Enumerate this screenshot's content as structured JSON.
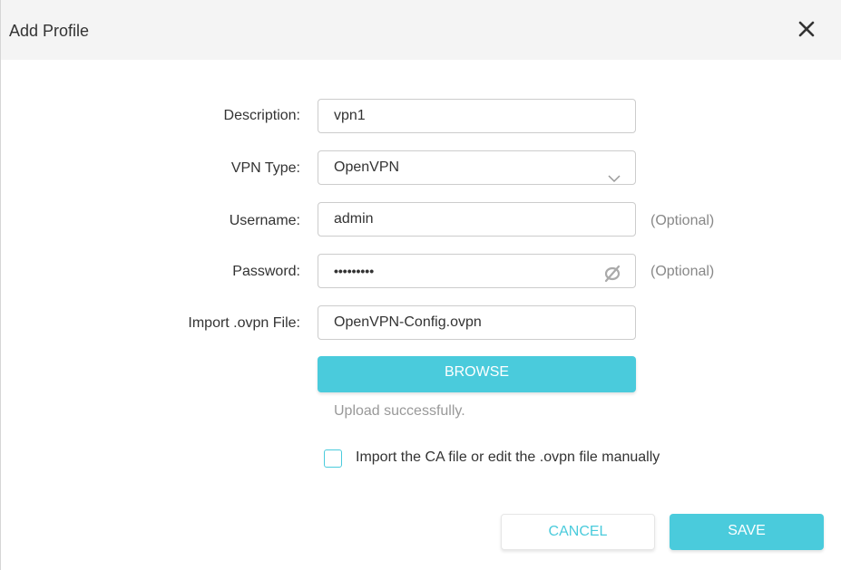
{
  "dialog": {
    "title": "Add Profile",
    "close_icon": "close-icon"
  },
  "form": {
    "description": {
      "label": "Description:",
      "value": "vpn1"
    },
    "vpn_type": {
      "label": "VPN Type:",
      "value": "OpenVPN",
      "icon": "chevron-down-icon"
    },
    "username": {
      "label": "Username:",
      "value": "admin",
      "hint": "(Optional)"
    },
    "password": {
      "label": "Password:",
      "value": "•••••••••",
      "hint": "(Optional)",
      "icon": "eye-off-icon"
    },
    "import_file": {
      "label": "Import .ovpn File:",
      "value": "OpenVPN-Config.ovpn"
    },
    "browse_label": "BROWSE",
    "status": "Upload successfully.",
    "manual_checkbox": {
      "label": "Import the CA file or edit the .ovpn file manually",
      "checked": false
    }
  },
  "footer": {
    "cancel_label": "CANCEL",
    "save_label": "SAVE"
  },
  "colors": {
    "accent": "#4acbdc",
    "header_bg": "#f4f4f4",
    "hint": "#888888"
  }
}
